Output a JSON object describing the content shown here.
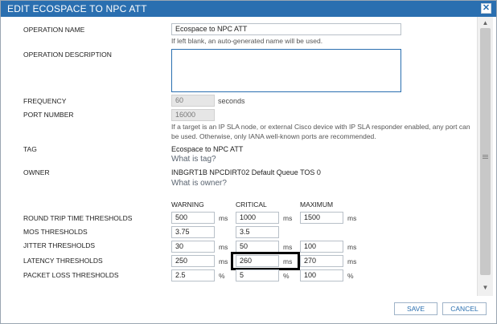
{
  "dialog": {
    "title": "EDIT ECOSPACE TO NPC ATT",
    "close_glyph": "✕"
  },
  "form": {
    "operation_name": {
      "label": "OPERATION NAME",
      "value": "Ecospace to NPC ATT",
      "hint": "If left blank, an auto-generated name will be used."
    },
    "operation_description": {
      "label": "OPERATION DESCRIPTION",
      "value": ""
    },
    "frequency": {
      "label": "FREQUENCY",
      "value": "60",
      "unit": "seconds"
    },
    "port_number": {
      "label": "PORT NUMBER",
      "value": "16000",
      "hint": "If a target is an IP SLA node, or external Cisco device with IP SLA responder enabled, any port can be used. Otherwise, only IANA well-known ports are recommended."
    },
    "tag": {
      "label": "TAG",
      "value": "Ecospace to NPC ATT",
      "help": "What is tag?"
    },
    "owner": {
      "label": "OWNER",
      "value": "INBGRT1B NPCDIRT02 Default Queue TOS 0",
      "help": "What is owner?"
    }
  },
  "thresholds": {
    "columns": [
      "WARNING",
      "CRITICAL",
      "MAXIMUM"
    ],
    "rows": [
      {
        "label": "ROUND TRIP TIME THRESHOLDS",
        "warning": "500",
        "warning_unit": "ms",
        "critical": "1000",
        "critical_unit": "ms",
        "maximum": "1500",
        "maximum_unit": "ms"
      },
      {
        "label": "MOS THRESHOLDS",
        "warning": "3.75",
        "warning_unit": "",
        "critical": "3.5",
        "critical_unit": "",
        "maximum": "",
        "maximum_unit": ""
      },
      {
        "label": "JITTER THRESHOLDS",
        "warning": "30",
        "warning_unit": "ms",
        "critical": "50",
        "critical_unit": "ms",
        "maximum": "100",
        "maximum_unit": "ms"
      },
      {
        "label": "LATENCY THRESHOLDS",
        "warning": "250",
        "warning_unit": "ms",
        "critical": "260",
        "critical_unit": "ms",
        "maximum": "270",
        "maximum_unit": "ms"
      },
      {
        "label": "PACKET LOSS THRESHOLDS",
        "warning": "2.5",
        "warning_unit": "%",
        "critical": "5",
        "critical_unit": "%",
        "maximum": "100",
        "maximum_unit": "%"
      }
    ]
  },
  "footer": {
    "save_label": "SAVE",
    "cancel_label": "CANCEL"
  },
  "scrollbar": {
    "up_glyph": "▲",
    "down_glyph": "▼"
  }
}
